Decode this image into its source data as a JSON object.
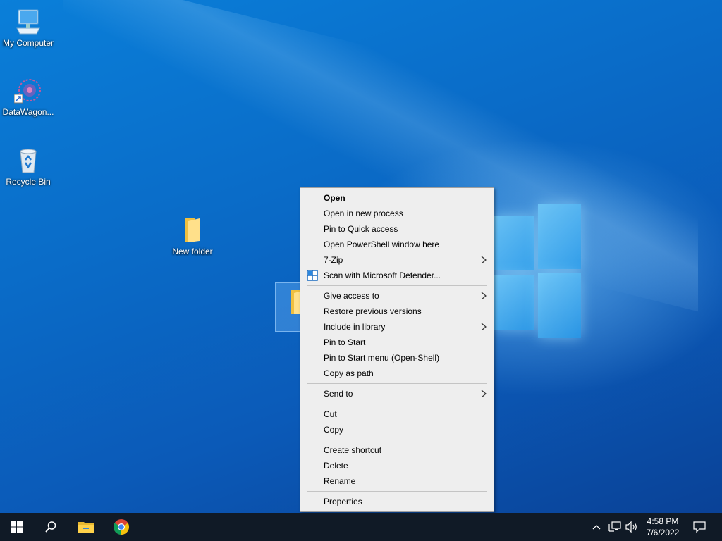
{
  "desktop": {
    "icons": [
      {
        "label": "My Computer",
        "icon": "computer-icon"
      },
      {
        "label": "DataWagon...",
        "icon": "app-shortcut-icon"
      },
      {
        "label": "Recycle Bin",
        "icon": "recycle-bin-icon"
      },
      {
        "label": "New folder",
        "icon": "folder-icon"
      }
    ]
  },
  "context_menu": {
    "group1": [
      {
        "label": "Open",
        "bold": true
      },
      {
        "label": "Open in new process"
      },
      {
        "label": "Pin to Quick access"
      },
      {
        "label": "Open PowerShell window here"
      },
      {
        "label": "7-Zip",
        "submenu": true
      },
      {
        "label": "Scan with Microsoft Defender...",
        "icon": "defender-shield-icon"
      }
    ],
    "group2": [
      {
        "label": "Give access to",
        "submenu": true
      },
      {
        "label": "Restore previous versions"
      },
      {
        "label": "Include in library",
        "submenu": true
      },
      {
        "label": "Pin to Start"
      },
      {
        "label": "Pin to Start menu (Open-Shell)"
      },
      {
        "label": "Copy as path"
      }
    ],
    "group3": [
      {
        "label": "Send to",
        "submenu": true
      }
    ],
    "group4": [
      {
        "label": "Cut"
      },
      {
        "label": "Copy"
      }
    ],
    "group5": [
      {
        "label": "Create shortcut"
      },
      {
        "label": "Delete"
      },
      {
        "label": "Rename"
      }
    ],
    "group6": [
      {
        "label": "Properties"
      }
    ]
  },
  "taskbar": {
    "buttons": [
      "start-icon",
      "search-icon",
      "file-explorer-icon",
      "chrome-icon"
    ],
    "tray": {
      "time": "4:58 PM",
      "date": "7/6/2022"
    }
  },
  "colors": {
    "taskbar": "#101a26",
    "menu_bg": "#eeeeee",
    "desktop_blue": "#0a6cc8"
  }
}
